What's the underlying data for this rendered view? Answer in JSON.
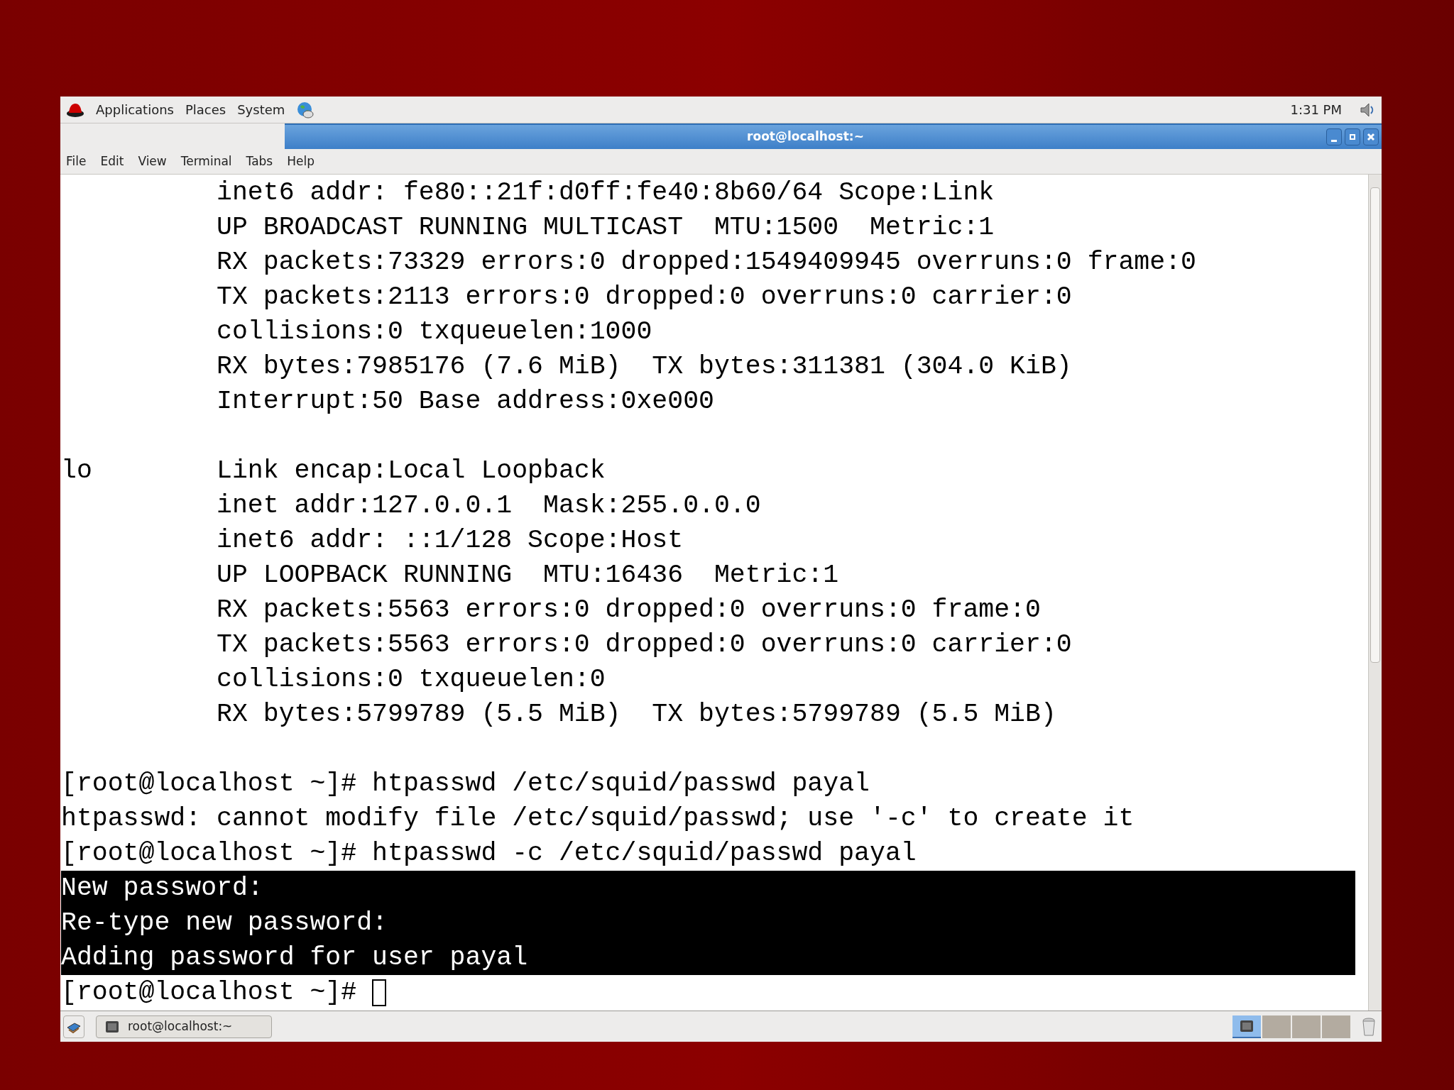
{
  "top_panel": {
    "menus": [
      "Applications",
      "Places",
      "System"
    ],
    "clock": "1:31 PM"
  },
  "window": {
    "title": "root@localhost:~",
    "menu": [
      "File",
      "Edit",
      "View",
      "Terminal",
      "Tabs",
      "Help"
    ]
  },
  "terminal": {
    "lines": [
      {
        "kind": "text",
        "text": "          inet6 addr: fe80::21f:d0ff:fe40:8b60/64 Scope:Link",
        "highlighted": false
      },
      {
        "kind": "text",
        "text": "          UP BROADCAST RUNNING MULTICAST  MTU:1500  Metric:1",
        "highlighted": false
      },
      {
        "kind": "text",
        "text": "          RX packets:73329 errors:0 dropped:1549409945 overruns:0 frame:0",
        "highlighted": false
      },
      {
        "kind": "text",
        "text": "          TX packets:2113 errors:0 dropped:0 overruns:0 carrier:0",
        "highlighted": false
      },
      {
        "kind": "text",
        "text": "          collisions:0 txqueuelen:1000",
        "highlighted": false
      },
      {
        "kind": "text",
        "text": "          RX bytes:7985176 (7.6 MiB)  TX bytes:311381 (304.0 KiB)",
        "highlighted": false
      },
      {
        "kind": "text",
        "text": "          Interrupt:50 Base address:0xe000",
        "highlighted": false
      },
      {
        "kind": "blank"
      },
      {
        "kind": "text",
        "text": "lo        Link encap:Local Loopback",
        "highlighted": false
      },
      {
        "kind": "text",
        "text": "          inet addr:127.0.0.1  Mask:255.0.0.0",
        "highlighted": false
      },
      {
        "kind": "text",
        "text": "          inet6 addr: ::1/128 Scope:Host",
        "highlighted": false
      },
      {
        "kind": "text",
        "text": "          UP LOOPBACK RUNNING  MTU:16436  Metric:1",
        "highlighted": false
      },
      {
        "kind": "text",
        "text": "          RX packets:5563 errors:0 dropped:0 overruns:0 frame:0",
        "highlighted": false
      },
      {
        "kind": "text",
        "text": "          TX packets:5563 errors:0 dropped:0 overruns:0 carrier:0",
        "highlighted": false
      },
      {
        "kind": "text",
        "text": "          collisions:0 txqueuelen:0",
        "highlighted": false
      },
      {
        "kind": "text",
        "text": "          RX bytes:5799789 (5.5 MiB)  TX bytes:5799789 (5.5 MiB)",
        "highlighted": false
      },
      {
        "kind": "blank"
      },
      {
        "kind": "text",
        "text": "[root@localhost ~]# htpasswd /etc/squid/passwd payal",
        "highlighted": false
      },
      {
        "kind": "text",
        "text": "htpasswd: cannot modify file /etc/squid/passwd; use '-c' to create it",
        "highlighted": false
      },
      {
        "kind": "text",
        "text": "[root@localhost ~]# htpasswd -c /etc/squid/passwd payal",
        "highlighted": false
      },
      {
        "kind": "text",
        "text": "New password:",
        "highlighted": true
      },
      {
        "kind": "text",
        "text": "Re-type new password:",
        "highlighted": true
      },
      {
        "kind": "text",
        "text": "Adding password for user payal",
        "highlighted": true
      },
      {
        "kind": "prompt",
        "text": "[root@localhost ~]#",
        "highlighted": false
      }
    ]
  },
  "taskbar": {
    "tasks": [
      {
        "label": "root@localhost:~"
      }
    ],
    "workspaces": [
      {
        "selected": true
      },
      {
        "selected": false
      },
      {
        "selected": false
      },
      {
        "selected": false
      }
    ]
  }
}
